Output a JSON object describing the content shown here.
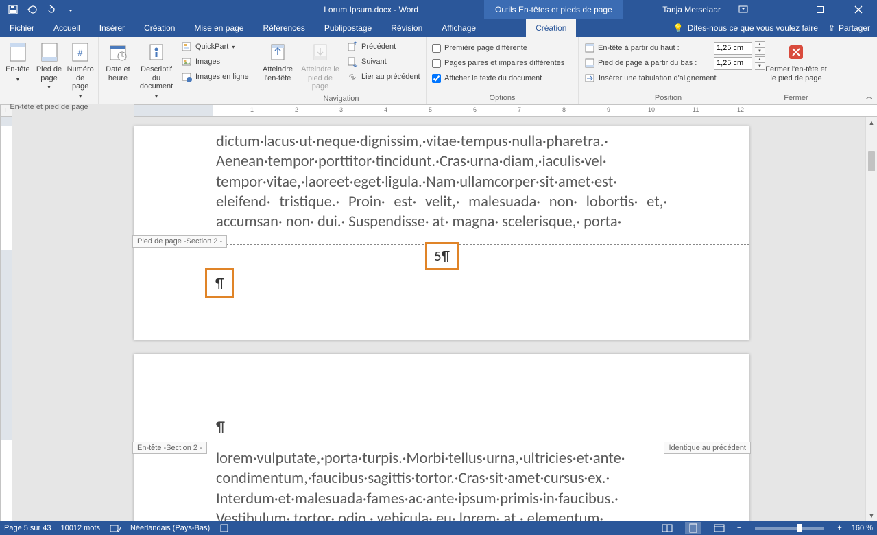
{
  "title": {
    "doc": "Lorum Ipsum.docx",
    "app": "Word",
    "context_tab": "Outils En-têtes et pieds de page",
    "user": "Tanja Metselaar"
  },
  "tabs": {
    "file": "Fichier",
    "home": "Accueil",
    "insert": "Insérer",
    "design": "Création",
    "layout": "Mise en page",
    "references": "Références",
    "mailings": "Publipostage",
    "review": "Révision",
    "view": "Affichage",
    "hf_design": "Création",
    "tell_me": "Dites-nous ce que vous voulez faire",
    "share": "Partager"
  },
  "ribbon": {
    "group_hf": {
      "label": "En-tête et pied de page",
      "header": "En-tête",
      "footer": "Pied de page",
      "pagenum": "Numéro de page"
    },
    "group_insert": {
      "label": "Insérer",
      "datetime": "Date et heure",
      "docinfo": "Descriptif du document",
      "quickparts": "QuickPart",
      "images": "Images",
      "online_images": "Images en ligne"
    },
    "group_nav": {
      "label": "Navigation",
      "goto_header": "Atteindre l'en-tête",
      "goto_footer": "Atteindre le pied de page",
      "prev": "Précédent",
      "next": "Suivant",
      "link_prev": "Lier au précédent"
    },
    "group_options": {
      "label": "Options",
      "diff_first": "Première page différente",
      "diff_oddeven": "Pages paires et impaires différentes",
      "show_doc": "Afficher le texte du document"
    },
    "group_position": {
      "label": "Position",
      "header_from_top": "En-tête à partir du haut :",
      "footer_from_bottom": "Pied de page à partir du bas :",
      "align_tab": "Insérer une tabulation d'alignement",
      "val_header": "1,25 cm",
      "val_footer": "1,25 cm"
    },
    "group_close": {
      "label": "Fermer",
      "close_btn": "Fermer l'en-tête et le pied de page"
    }
  },
  "document": {
    "para1": "dictum·lacus·ut·neque·dignissim,·vitae·tempus·nulla·pharetra.· Aenean·tempor·porttitor·tincidunt.·Cras·urna·diam,·iaculis·vel· tempor·vitae,·laoreet·eget·ligula.·Nam·ullamcorper·sit·amet·est· eleifend· tristique.· Proin· est· velit,· malesuada· non· lobortis· et,· accumsan· non· dui.· Suspendisse· at· magna· scelerisque,· porta·",
    "footer_tab": "Pied de page -Section 2 -",
    "page_number": "5¶",
    "pilcrow": "¶",
    "header_tab": "En-tête -Section 2 -",
    "same_as_prev": "Identique au précédent",
    "para2": "lorem·vulputate,·porta·turpis.·Morbi·tellus·urna,·ultricies·et·ante· condimentum,·faucibus·sagittis·tortor.·Cras·sit·amet·cursus·ex.· Interdum·et·malesuada·fames·ac·ante·ipsum·primis·in·faucibus.· Vestibulum· tortor· odio,· vehicula· eu· lorem· at,· elementum·"
  },
  "statusbar": {
    "page": "Page 5 sur 43",
    "words": "10012 mots",
    "lang": "Néerlandais (Pays-Bas)",
    "zoom": "160 %"
  }
}
